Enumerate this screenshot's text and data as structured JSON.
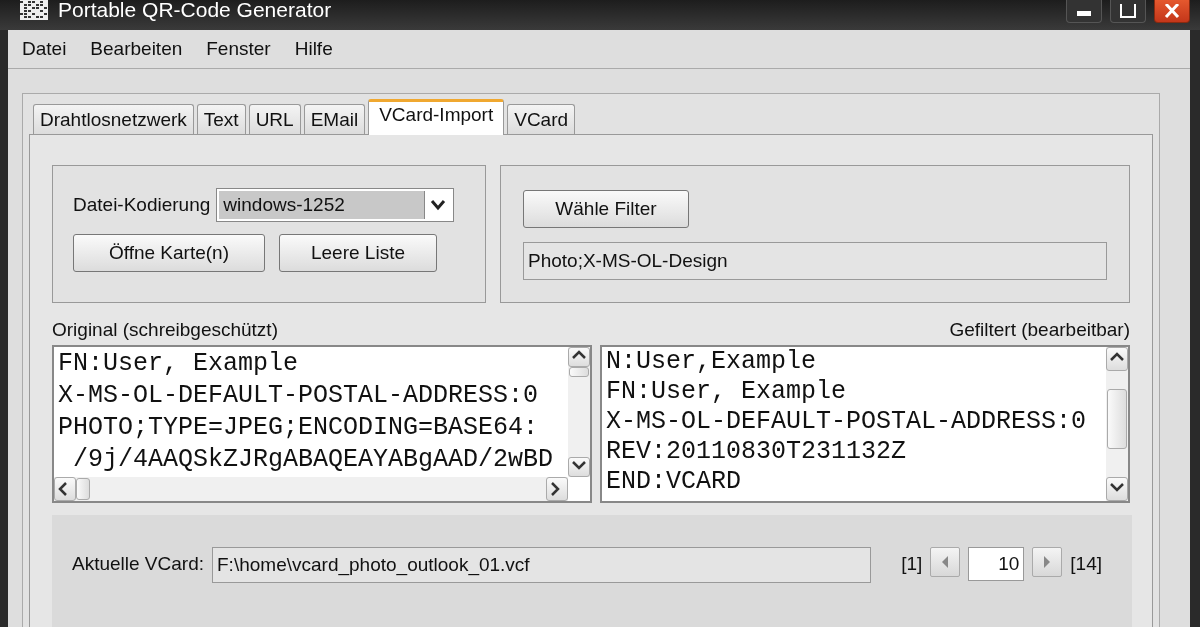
{
  "window": {
    "title": "Portable QR-Code Generator"
  },
  "menu": [
    "Datei",
    "Bearbeiten",
    "Fenster",
    "Hilfe"
  ],
  "tabs": [
    {
      "label": "Drahtlosnetzwerk",
      "selected": false
    },
    {
      "label": "Text",
      "selected": false
    },
    {
      "label": "URL",
      "selected": false
    },
    {
      "label": "EMail",
      "selected": false
    },
    {
      "label": "VCard-Import",
      "selected": true
    },
    {
      "label": "VCard",
      "selected": false
    }
  ],
  "encoding": {
    "label": "Datei-Kodierung",
    "value": "windows-1252"
  },
  "buttons": [
    {
      "kind": "open",
      "label": "Öffne Karte(n)"
    },
    {
      "kind": "clear",
      "label": "Leere Liste"
    }
  ],
  "filter": {
    "button": "Wähle Filter",
    "value": "Photo;X-MS-OL-Design"
  },
  "original": {
    "label": "Original (schreibgeschützt)",
    "lines": [
      "FN:User, Example",
      "X-MS-OL-DEFAULT-POSTAL-ADDRESS:0",
      "PHOTO;TYPE=JPEG;ENCODING=BASE64:",
      " /9j/4AAQSkZJRgABAQEAYABgAAD/2wBD"
    ]
  },
  "filtered": {
    "label": "Gefiltert (bearbeitbar)",
    "lines": [
      "N:User,Example",
      "FN:User, Example",
      "X-MS-OL-DEFAULT-POSTAL-ADDRESS:0",
      "REV:20110830T231132Z",
      "END:VCARD"
    ]
  },
  "current": {
    "label": "Aktuelle VCard:",
    "path": "F:\\home\\vcard_photo_outlook_01.vcf",
    "first": "[1]",
    "index": "10",
    "last": "[14]"
  }
}
